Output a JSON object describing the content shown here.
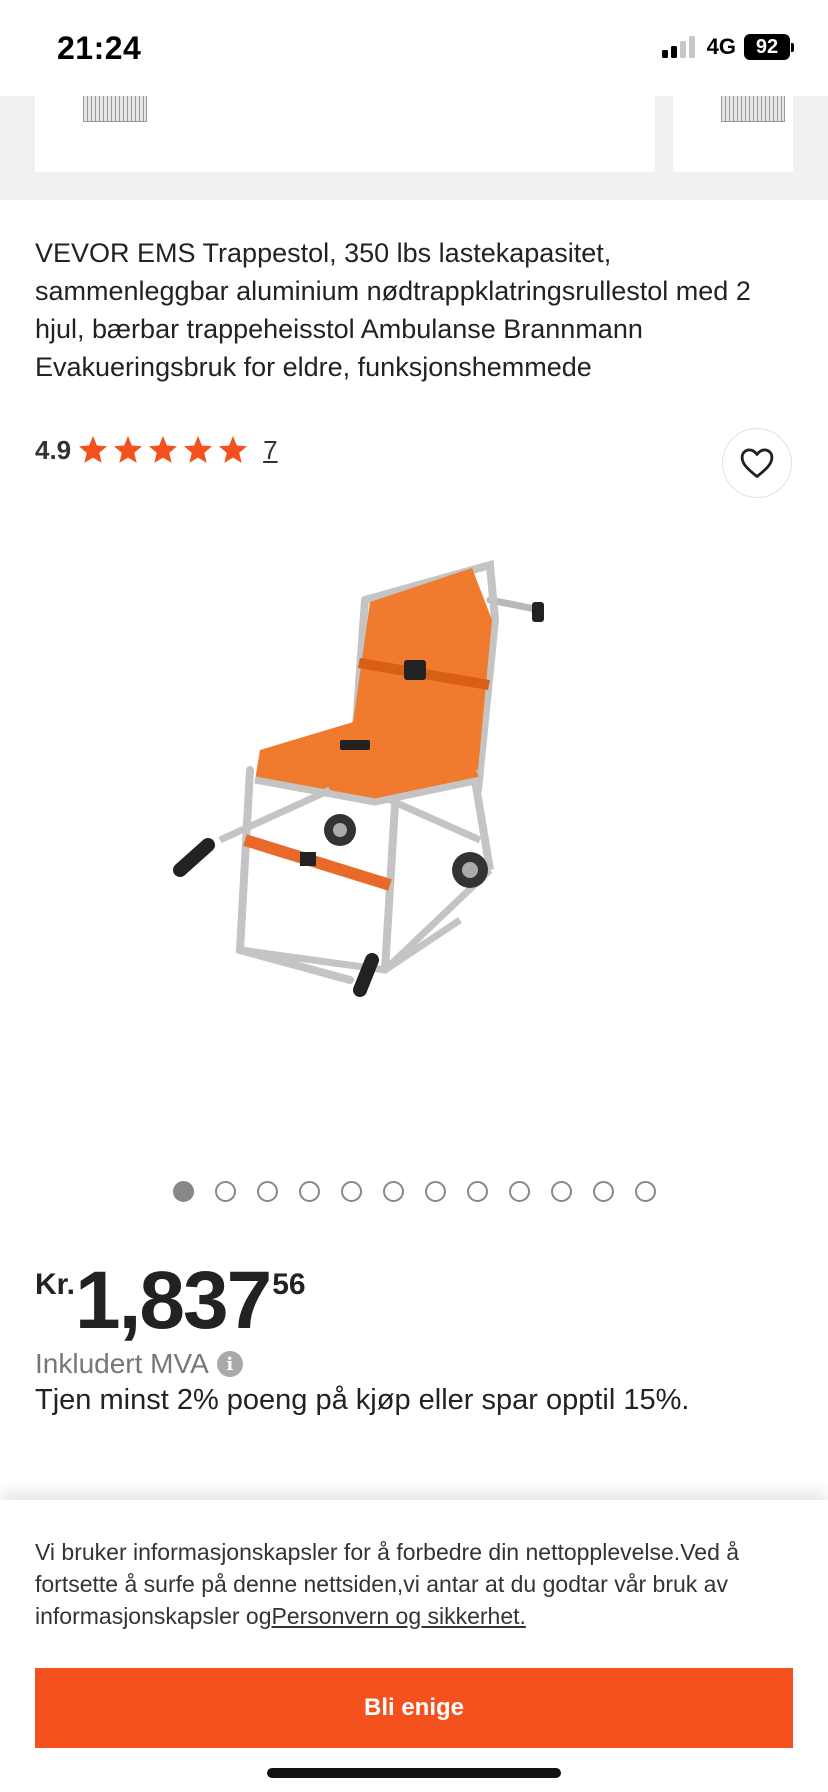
{
  "status_bar": {
    "time": "21:24",
    "network": "4G",
    "battery": "92"
  },
  "product": {
    "title": "VEVOR EMS Trappestol, 350 lbs lastekapasitet, sammenleggbar aluminium nødtrappklatringsrullestol med 2 hjul, bærbar trappeheisstol Ambulanse Brannmann Evakueringsbruk for eldre, funksjonshemmede",
    "rating_value": "4.9",
    "rating_stars": 5,
    "review_count": "7",
    "image_count": 12,
    "active_image_index": 0
  },
  "price": {
    "currency": "Kr.",
    "main": "1,837",
    "cents": "56",
    "vat_label": "Inkludert MVA",
    "info_icon": "i",
    "points_text": "Tjen minst 2% poeng på kjøp eller spar opptil 15%."
  },
  "cookie_banner": {
    "text": "Vi bruker informasjonskapsler for å forbedre din nettopplevelse.Ved å fortsette å surfe på denne nettsiden,vi antar at du godtar vår bruk av informasjonskapsler og",
    "link_text": "Personvern og sikkerhet.",
    "agree_label": "Bli enige"
  },
  "colors": {
    "accent": "#f4511e",
    "star": "#f4511e",
    "chair": "#f07a2e"
  }
}
